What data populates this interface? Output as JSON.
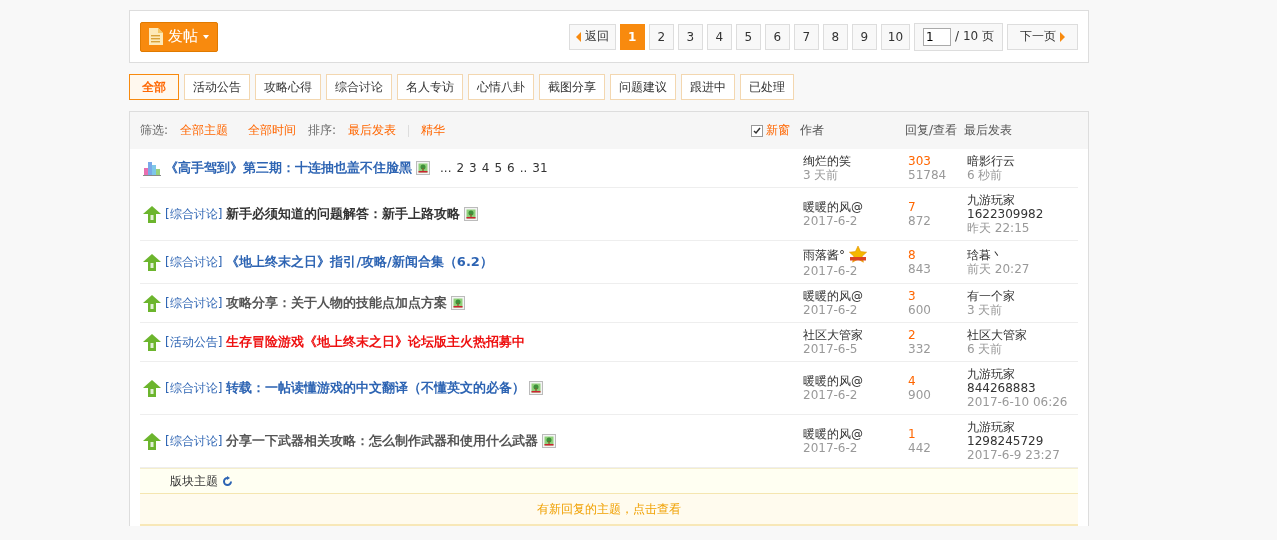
{
  "toolbar": {
    "post_button": "发帖",
    "back_button": "返回",
    "pages": [
      {
        "label": "1",
        "selected": true
      },
      {
        "label": "2",
        "selected": false
      },
      {
        "label": "3",
        "selected": false
      },
      {
        "label": "4",
        "selected": false
      },
      {
        "label": "5",
        "selected": false
      },
      {
        "label": "6",
        "selected": false
      },
      {
        "label": "7",
        "selected": false
      },
      {
        "label": "8",
        "selected": false
      },
      {
        "label": "9",
        "selected": false
      },
      {
        "label": "10",
        "selected": false
      }
    ],
    "page_input": "1",
    "page_total": "/ 10 页",
    "next_button": "下一页"
  },
  "categories": [
    {
      "label": "全部",
      "selected": true
    },
    {
      "label": "活动公告",
      "selected": false
    },
    {
      "label": "攻略心得",
      "selected": false
    },
    {
      "label": "综合讨论",
      "selected": false
    },
    {
      "label": "名人专访",
      "selected": false
    },
    {
      "label": "心情八卦",
      "selected": false
    },
    {
      "label": "截图分享",
      "selected": false
    },
    {
      "label": "问题建议",
      "selected": false
    },
    {
      "label": "跟进中",
      "selected": false
    },
    {
      "label": "已处理",
      "selected": false
    }
  ],
  "filter_bar": {
    "filter_label": "筛选:",
    "filters": [
      "全部主题",
      "全部时间"
    ],
    "sort_label": "排序:",
    "sort": "最后发表",
    "digest": "精华",
    "new_window": {
      "label": "新窗",
      "checked": true
    },
    "columns": [
      "作者",
      "回复/查看",
      "最后发表"
    ]
  },
  "threads": [
    {
      "kind": "stats",
      "title": "《高手驾到》第三期：十连抽也盖不住脸黑",
      "color": "#2d64b3",
      "has_image": true,
      "pages": [
        "...",
        "2",
        "3",
        "4",
        "5",
        "6",
        "..",
        "31"
      ],
      "author": "绚烂的笑",
      "date": "3 天前",
      "badge": false,
      "replies": "303",
      "views": "51784",
      "last_poster": "暗影行云",
      "last_time": "6 秒前"
    },
    {
      "kind": "top",
      "tag": "[综合讨论]",
      "title": "新手必须知道的问题解答：新手上路攻略",
      "color": "#333333",
      "has_image": true,
      "author": "暖暖的风@",
      "date": "2017-6-2",
      "badge": false,
      "replies": "7",
      "views": "872",
      "last_poster": "九游玩家",
      "last_id": "1622309982",
      "last_time": "昨天 22:15"
    },
    {
      "kind": "top",
      "tag": "[综合讨论]",
      "title": "《地上终末之日》指引/攻略/新闻合集（6.2）",
      "color": "#2d64b3",
      "has_image": false,
      "author": "雨落酱°",
      "date": "2017-6-2",
      "badge": true,
      "replies": "8",
      "views": "843",
      "last_poster": "琀暮丶",
      "last_time": "前天 20:27"
    },
    {
      "kind": "top",
      "tag": "[综合讨论]",
      "title": "攻略分享：关于人物的技能点加点方案",
      "color": "#555555",
      "has_image": true,
      "author": "暖暖的风@",
      "date": "2017-6-2",
      "badge": false,
      "replies": "3",
      "views": "600",
      "last_poster": "有一个家",
      "last_time": "3 天前"
    },
    {
      "kind": "top",
      "tag": "[活动公告]",
      "title": "生存冒险游戏《地上终末之日》论坛版主火热招募中",
      "color": "#ee1111",
      "has_image": false,
      "author": "社区大管家",
      "date": "2017-6-5",
      "badge": false,
      "replies": "2",
      "views": "332",
      "last_poster": "社区大管家",
      "last_time": "6 天前"
    },
    {
      "kind": "top",
      "tag": "[综合讨论]",
      "title": "转载：一帖读懂游戏的中文翻译（不懂英文的必备）",
      "color": "#2d64b3",
      "has_image": true,
      "author": "暖暖的风@",
      "date": "2017-6-2",
      "badge": false,
      "replies": "4",
      "views": "900",
      "last_poster": "九游玩家",
      "last_id": "844268883",
      "last_time": "2017-6-10 06:26"
    },
    {
      "kind": "top",
      "tag": "[综合讨论]",
      "title": "分享一下武器相关攻略：怎么制作武器和使用什么武器",
      "color": "#555555",
      "has_image": true,
      "author": "暖暖的风@",
      "date": "2017-6-2",
      "badge": false,
      "replies": "1",
      "views": "442",
      "last_poster": "九游玩家",
      "last_id": "1298245729",
      "last_time": "2017-6-9 23:27"
    }
  ],
  "section_row": {
    "label": "版块主题"
  },
  "new_replies_bar": "有新回复的主题，点击查看"
}
